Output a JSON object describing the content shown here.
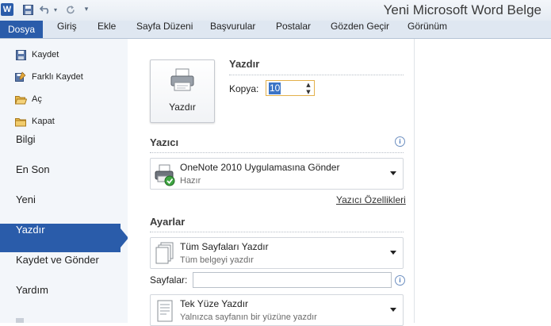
{
  "app": {
    "title": "Yeni Microsoft Word Belge",
    "logo_letter": "W"
  },
  "quick_access": [
    "save-icon",
    "undo-icon",
    "redo-icon",
    "customize-icon"
  ],
  "tabs": [
    {
      "label": "Dosya"
    },
    {
      "label": "Giriş"
    },
    {
      "label": "Ekle"
    },
    {
      "label": "Sayfa Düzeni"
    },
    {
      "label": "Başvurular"
    },
    {
      "label": "Postalar"
    },
    {
      "label": "Gözden Geçir"
    },
    {
      "label": "Görünüm"
    }
  ],
  "nav": {
    "small_items": [
      {
        "label": "Kaydet",
        "icon": "save-icon"
      },
      {
        "label": "Farklı Kaydet",
        "icon": "save-as-icon"
      },
      {
        "label": "Aç",
        "icon": "open-folder-icon"
      },
      {
        "label": "Kapat",
        "icon": "close-folder-icon"
      }
    ],
    "big_items": [
      {
        "label": "Bilgi"
      },
      {
        "label": "En Son"
      },
      {
        "label": "Yeni"
      },
      {
        "label": "Yazdır",
        "selected": true
      },
      {
        "label": "Kaydet ve Gönder"
      },
      {
        "label": "Yardım"
      }
    ]
  },
  "print": {
    "button_label": "Yazdır",
    "section_title": "Yazdır",
    "copies_label": "Kopya:",
    "copies_value": "10"
  },
  "printer": {
    "section_title": "Yazıcı",
    "name": "OneNote 2010 Uygulamasına Gönder",
    "status": "Hazır",
    "properties_link": "Yazıcı Özellikleri"
  },
  "settings": {
    "section_title": "Ayarlar",
    "pages_range": {
      "main": "Tüm Sayfaları Yazdır",
      "sub": "Tüm belgeyi yazdır"
    },
    "pages_label": "Sayfalar:",
    "pages_value": "",
    "sides": {
      "main": "Tek Yüze Yazdır",
      "sub": "Yalnızca sayfanın bir yüzüne yazdır"
    }
  },
  "colors": {
    "accent": "#2a5caa",
    "ribbon_bg": "#dfe7f1",
    "nav_bg": "#f3f6fa"
  }
}
